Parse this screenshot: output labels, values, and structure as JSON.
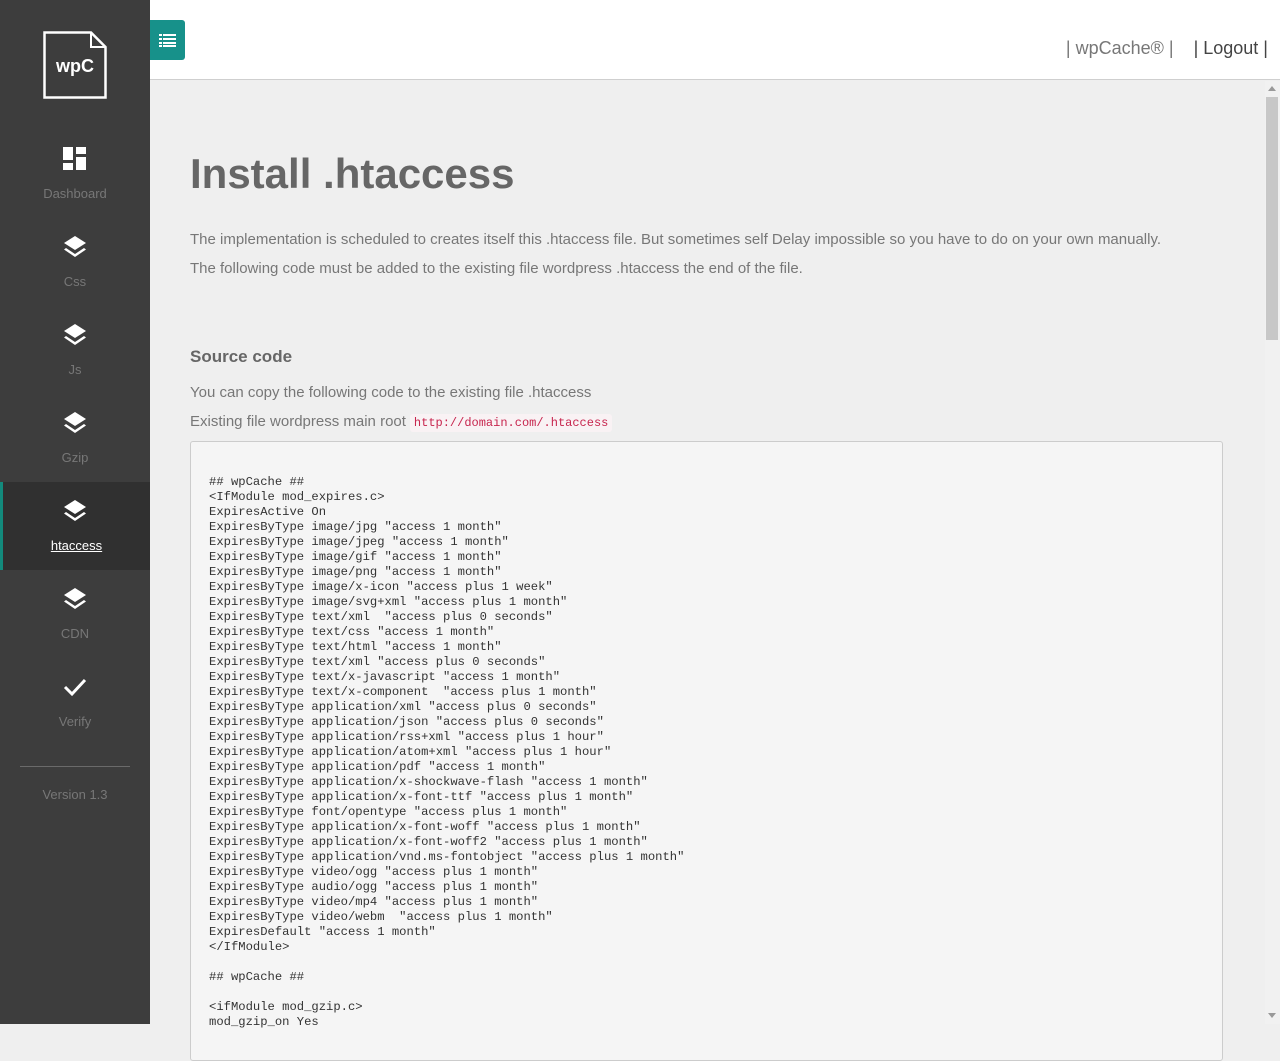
{
  "sidebar": {
    "logo_text": "wpC",
    "items": [
      {
        "label": "Dashboard",
        "icon": "dashboard-icon"
      },
      {
        "label": "Css",
        "icon": "layers-icon"
      },
      {
        "label": "Js",
        "icon": "layers-icon"
      },
      {
        "label": "Gzip",
        "icon": "layers-icon"
      },
      {
        "label": "htaccess",
        "icon": "layers-icon",
        "active": true
      },
      {
        "label": "CDN",
        "icon": "layers-icon"
      },
      {
        "label": "Verify",
        "icon": "check-icon"
      }
    ],
    "version": "Version 1.3"
  },
  "topbar": {
    "menu_icon": "list-icon",
    "brand_link": "| wpCache® |",
    "logout_link": "| Logout |"
  },
  "page": {
    "title": "Install .htaccess",
    "intro_1": "The implementation is scheduled to creates itself this .htaccess file. But sometimes self Delay impossible so you have to do on your own manually.",
    "intro_2": "The following code must be added to the existing file wordpress .htaccess the end of the file.",
    "section_title": "Source code",
    "copy_hint": "You can copy the following code to the existing file .htaccess",
    "root_label": "Existing file wordpress main root",
    "root_path": "http://domain.com/.htaccess",
    "code": "## wpCache ##\n<IfModule mod_expires.c>\nExpiresActive On\nExpiresByType image/jpg \"access 1 month\"\nExpiresByType image/jpeg \"access 1 month\"\nExpiresByType image/gif \"access 1 month\"\nExpiresByType image/png \"access 1 month\"\nExpiresByType image/x-icon \"access plus 1 week\"\nExpiresByType image/svg+xml \"access plus 1 month\"\nExpiresByType text/xml  \"access plus 0 seconds\"\nExpiresByType text/css \"access 1 month\"\nExpiresByType text/html \"access 1 month\"\nExpiresByType text/xml \"access plus 0 seconds\"\nExpiresByType text/x-javascript \"access 1 month\"\nExpiresByType text/x-component  \"access plus 1 month\"\nExpiresByType application/xml \"access plus 0 seconds\"\nExpiresByType application/json \"access plus 0 seconds\"\nExpiresByType application/rss+xml \"access plus 1 hour\"\nExpiresByType application/atom+xml \"access plus 1 hour\"\nExpiresByType application/pdf \"access 1 month\"\nExpiresByType application/x-shockwave-flash \"access 1 month\"\nExpiresByType application/x-font-ttf \"access plus 1 month\"\nExpiresByType font/opentype \"access plus 1 month\"\nExpiresByType application/x-font-woff \"access plus 1 month\"\nExpiresByType application/x-font-woff2 \"access plus 1 month\"\nExpiresByType application/vnd.ms-fontobject \"access plus 1 month\"\nExpiresByType video/ogg \"access plus 1 month\"\nExpiresByType audio/ogg \"access plus 1 month\"\nExpiresByType video/mp4 \"access plus 1 month\"\nExpiresByType video/webm  \"access plus 1 month\"\nExpiresDefault \"access 1 month\"\n</IfModule>\n\n## wpCache ##\n\n<ifModule mod_gzip.c>\nmod_gzip_on Yes"
  },
  "colors": {
    "sidebar_bg": "#3d3d3d",
    "accent": "#17918a",
    "page_bg": "#efefef"
  }
}
